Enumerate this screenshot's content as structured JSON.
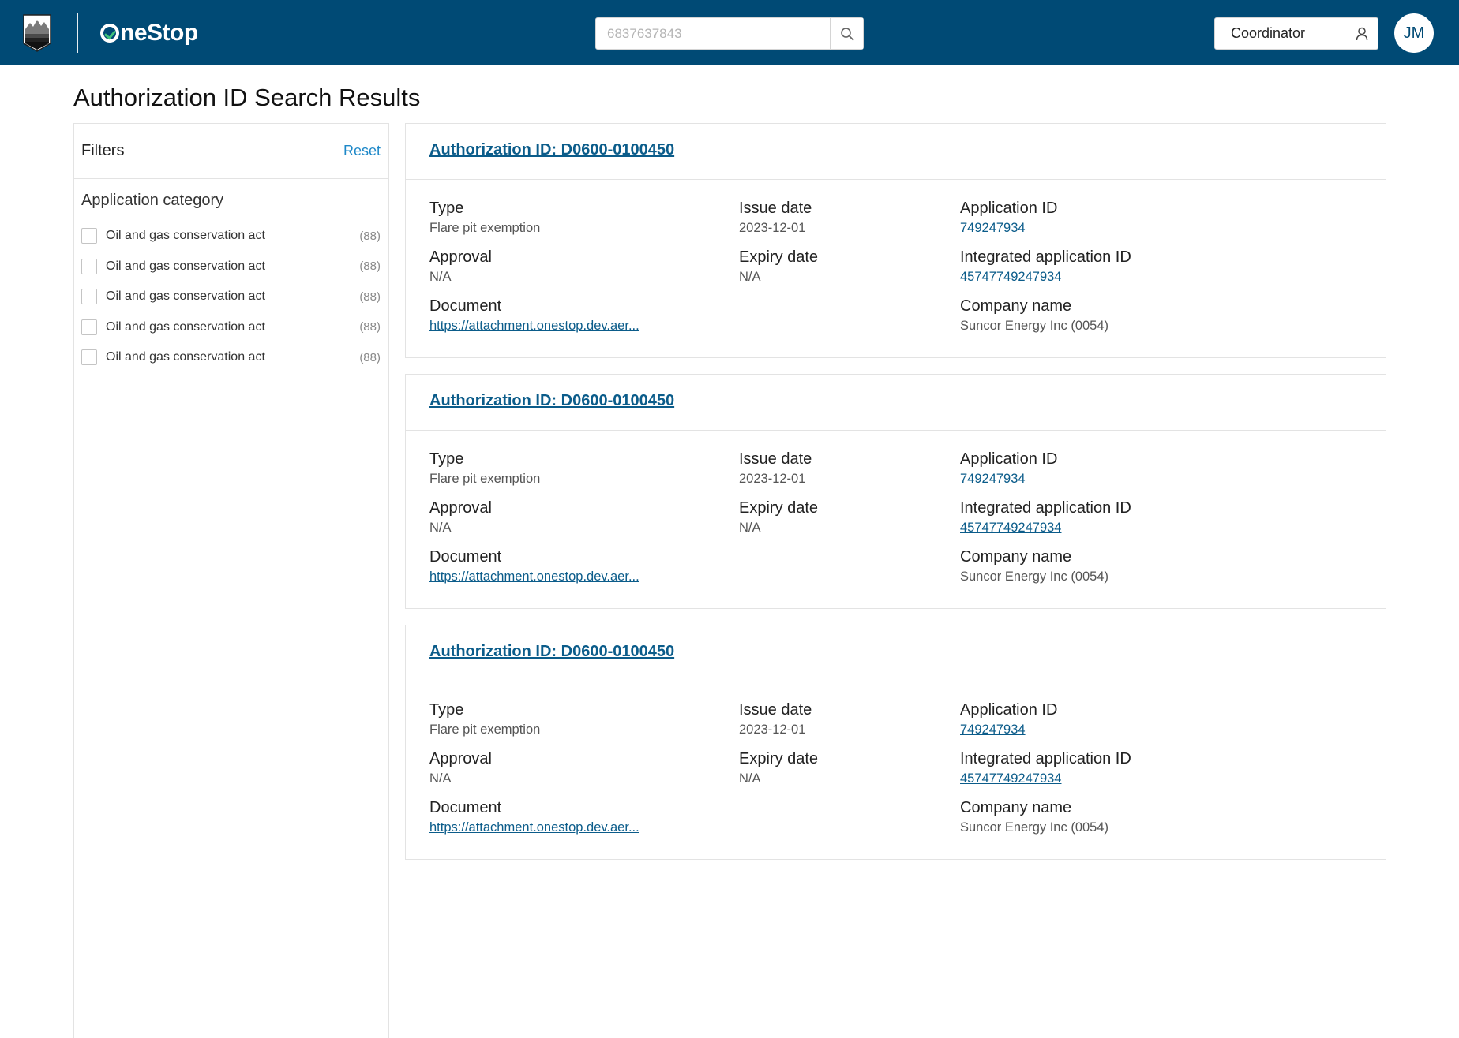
{
  "header": {
    "brand_text": "neStop",
    "search": {
      "placeholder": "6837637843",
      "value": ""
    },
    "role_label": "Coordinator",
    "avatar_initials": "JM",
    "colors": {
      "bar": "#004a75",
      "accent": "#3fc27a"
    },
    "icons": [
      "crest-logo",
      "search-icon",
      "user-icon"
    ]
  },
  "page": {
    "title": "Authorization ID Search Results"
  },
  "filters": {
    "title": "Filters",
    "reset_label": "Reset",
    "category_title": "Application category",
    "items": [
      {
        "label": "Oil and gas conservation act",
        "count": "(88)",
        "checked": false
      },
      {
        "label": "Oil and gas conservation act",
        "count": "(88)",
        "checked": false
      },
      {
        "label": "Oil and gas conservation act",
        "count": "(88)",
        "checked": false
      },
      {
        "label": "Oil and gas conservation act",
        "count": "(88)",
        "checked": false
      },
      {
        "label": "Oil and gas conservation act",
        "count": "(88)",
        "checked": false
      }
    ]
  },
  "labels": {
    "type": "Type",
    "approval": "Approval",
    "document": "Document",
    "issue_date": "Issue date",
    "expiry_date": "Expiry date",
    "application_id": "Application ID",
    "integrated_application_id": "Integrated application ID",
    "company_name": "Company name"
  },
  "results": [
    {
      "title": "Authorization ID: D0600-0100450",
      "type": "Flare pit exemption",
      "approval": "N/A",
      "document": "https://attachment.onestop.dev.aer...",
      "issue_date": "2023-12-01",
      "expiry_date": "N/A",
      "application_id": "749247934",
      "integrated_application_id": "45747749247934",
      "company_name": "Suncor Energy Inc (0054)"
    },
    {
      "title": "Authorization ID: D0600-0100450",
      "type": "Flare pit exemption",
      "approval": "N/A",
      "document": "https://attachment.onestop.dev.aer...",
      "issue_date": "2023-12-01",
      "expiry_date": "N/A",
      "application_id": "749247934",
      "integrated_application_id": "45747749247934",
      "company_name": "Suncor Energy Inc (0054)"
    },
    {
      "title": "Authorization ID: D0600-0100450",
      "type": "Flare pit exemption",
      "approval": "N/A",
      "document": "https://attachment.onestop.dev.aer...",
      "issue_date": "2023-12-01",
      "expiry_date": "N/A",
      "application_id": "749247934",
      "integrated_application_id": "45747749247934",
      "company_name": "Suncor Energy Inc (0054)"
    }
  ]
}
